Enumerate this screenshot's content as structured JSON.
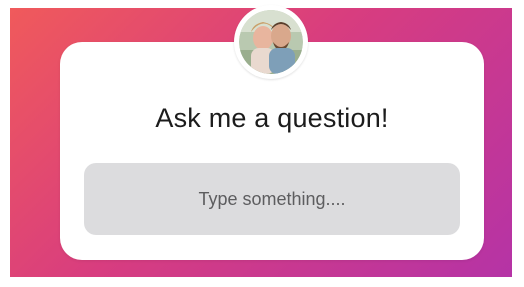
{
  "question_sticker": {
    "prompt": "Ask me a question!",
    "input_placeholder": "Type something....",
    "avatar_icon": "profile-photo-avatar"
  },
  "colors": {
    "gradient_start": "#f05a5b",
    "gradient_mid": "#d83d7f",
    "gradient_end": "#b533a6",
    "card_background": "#ffffff",
    "input_background": "#dcdcde",
    "prompt_text": "#1c1c1c",
    "placeholder_text": "#5d5d5f"
  }
}
